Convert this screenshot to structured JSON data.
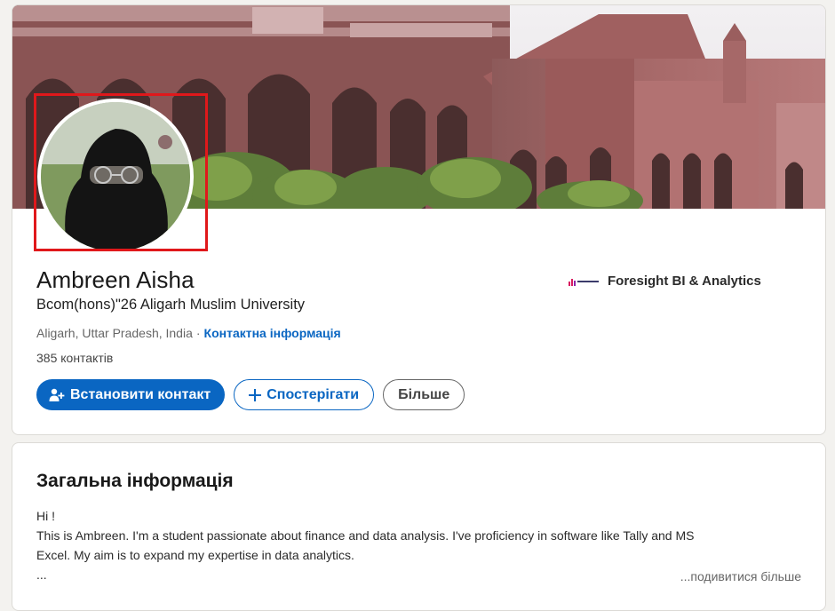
{
  "profile": {
    "name": "Ambreen Aisha",
    "headline": "Bcom(hons)\"26 Aligarh Muslim University",
    "location": "Aligarh, Uttar Pradesh, India",
    "separator": "·",
    "contact_info_link": "Контактна інформація",
    "connections": "385 контактів",
    "company": "Foresight BI & Analytics"
  },
  "actions": {
    "connect_label": "Встановити контакт",
    "follow_label": "Спостерігати",
    "more_label": "Більше"
  },
  "about": {
    "title": "Загальна інформація",
    "lines": [
      "Hi !",
      "This is Ambreen. I'm a student passionate about finance and data analysis. I've proficiency in software like Tally and MS",
      "Excel. My aim is to expand my expertise in data analytics.",
      "..."
    ],
    "see_more": "...подивитися більше"
  },
  "icons": {
    "connect": "add-person-icon",
    "follow": "plus-icon",
    "company_logo": "company-logo-icon"
  },
  "colors": {
    "accent": "#0a66c2",
    "highlight": "#e0181b"
  }
}
